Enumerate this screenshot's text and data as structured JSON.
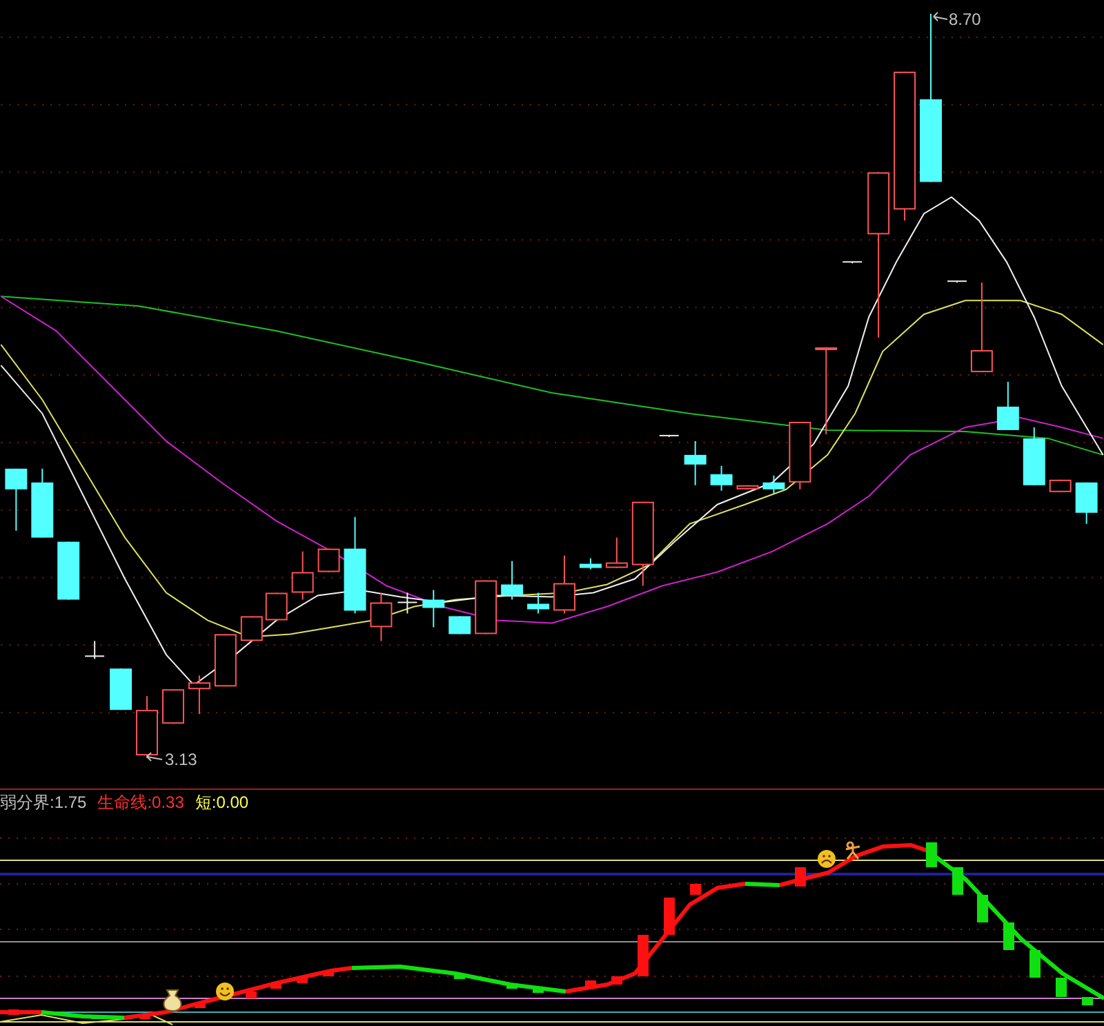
{
  "main_chart": {
    "high_label": "8.70",
    "low_label": "3.13"
  },
  "indicator": {
    "legend": [
      {
        "label": "弱分界:",
        "value": "1.75",
        "color": "#c0c0c0"
      },
      {
        "label": "生命线:",
        "value": "0.33",
        "color": "#ff3030"
      },
      {
        "label": "短:",
        "value": "0.00",
        "color": "#ffff54"
      }
    ]
  }
}
